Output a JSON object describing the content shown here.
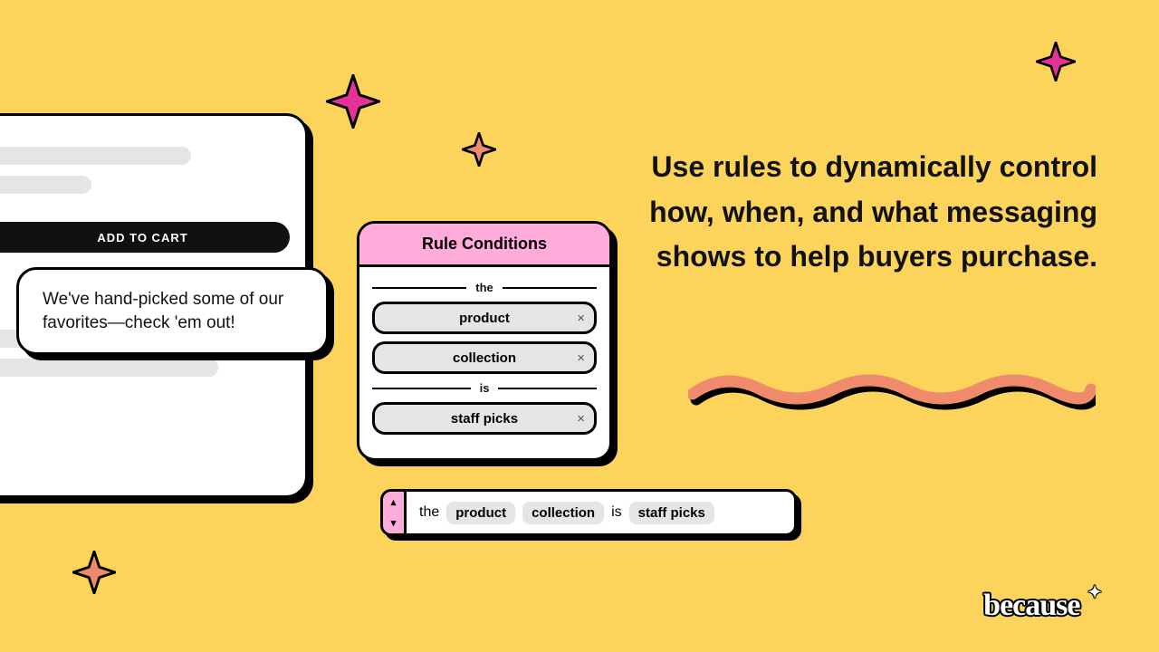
{
  "product": {
    "add_to_cart_label": "ADD TO CART",
    "callout_text": "We've hand-picked some of our favorites—check 'em out!"
  },
  "rules_panel": {
    "title": "Rule Conditions",
    "connector_the": "the",
    "connector_is": "is",
    "chip_product": "product",
    "chip_collection": "collection",
    "chip_staff_picks": "staff picks",
    "remove_symbol": "×"
  },
  "summary": {
    "word_the": "the",
    "tag_product": "product",
    "tag_collection": "collection",
    "word_is": "is",
    "tag_staff_picks": "staff picks"
  },
  "headline": "Use rules to dynamically control how, when, and what messaging shows to help buyers purchase.",
  "brand": {
    "name": "because"
  },
  "colors": {
    "bg": "#FCD45B",
    "pink": "#FFACDA",
    "magenta": "#E43397",
    "coral": "#F08A6C",
    "chip_grey": "#E5E5E5",
    "ink": "#111111"
  }
}
